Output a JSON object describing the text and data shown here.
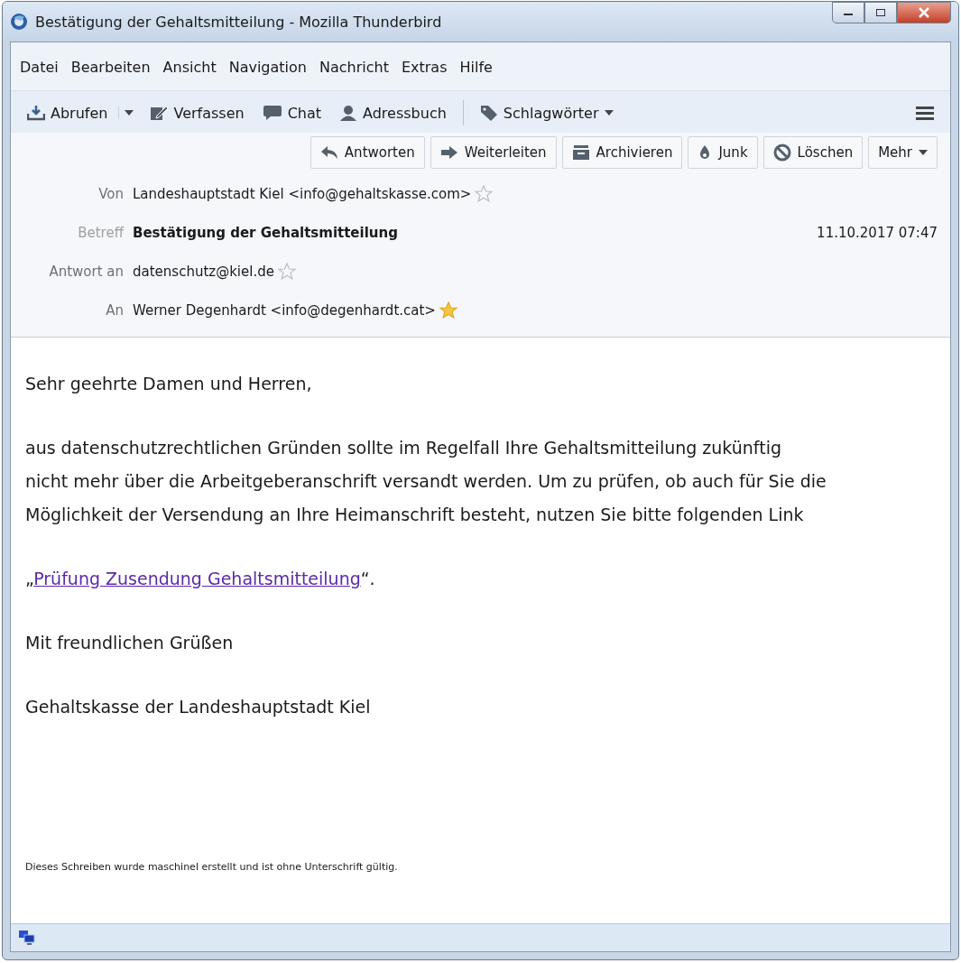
{
  "window": {
    "title": "Bestätigung der Gehaltsmitteilung - Mozilla Thunderbird"
  },
  "menu": [
    {
      "label": "Datei"
    },
    {
      "label": "Bearbeiten"
    },
    {
      "label": "Ansicht"
    },
    {
      "label": "Navigation"
    },
    {
      "label": "Nachricht"
    },
    {
      "label": "Extras"
    },
    {
      "label": "Hilfe"
    }
  ],
  "toolbar": [
    {
      "label": "Abrufen",
      "kind": "download"
    },
    {
      "kind": "dropdown"
    },
    {
      "label": "Verfassen",
      "kind": "compose"
    },
    {
      "label": "Chat",
      "kind": "chat"
    },
    {
      "label": "Adressbuch",
      "kind": "person"
    },
    {
      "label": "Schlagwörter",
      "kind": "tag"
    }
  ],
  "actions": [
    {
      "label": "Antworten",
      "kind": "reply"
    },
    {
      "label": "Weiterleiten",
      "kind": "forward"
    },
    {
      "label": "Archivieren",
      "kind": "archive"
    },
    {
      "label": "Junk",
      "kind": "junk"
    },
    {
      "label": "Löschen",
      "kind": "delete"
    },
    {
      "label": "Mehr",
      "kind": "more"
    }
  ],
  "headers": [
    {
      "label": "Von",
      "value": "Landeshauptstadt Kiel <info@gehaltskasse.com>",
      "kind": "address",
      "starred": false
    },
    {
      "label": "Betreff",
      "value": "Bestätigung der Gehaltsmitteilung",
      "kind": "subject",
      "date": "11.10.2017 07:47"
    },
    {
      "label": "Antwort an",
      "value": "datenschutz@kiel.de",
      "kind": "address",
      "starred": false
    },
    {
      "label": "An",
      "value": "Werner Degenhardt <info@degenhardt.cat>",
      "kind": "address",
      "starred": true
    }
  ],
  "body": {
    "greeting": "Sehr geehrte Damen und Herren,",
    "paragraph": "aus datenschutzrechtlichen Gründen sollte im Regelfall Ihre Gehaltsmitteilung zukünftig nicht mehr über die Arbeitgeberanschrift versandt werden. Um zu prüfen, ob auch für Sie die Möglichkeit der Versendung an Ihre Heimanschrift besteht, nutzen Sie bitte folgenden Link",
    "link_open": "„",
    "link": "Prüfung Zusendung Gehaltsmitteilung",
    "link_close": "“.",
    "closing": "Mit freundlichen Grüßen",
    "signature": "Gehaltskasse der Landeshauptstadt Kiel",
    "footnote": "Dieses Schreiben wurde maschinel erstellt und ist ohne Unterschrift gültig."
  }
}
